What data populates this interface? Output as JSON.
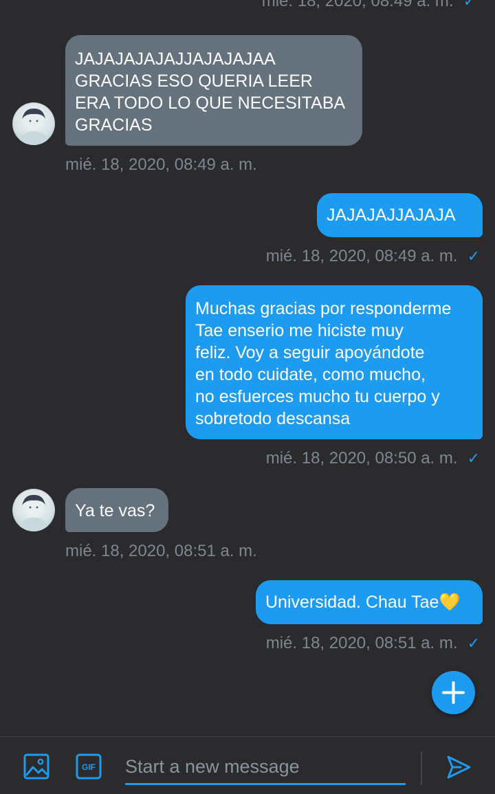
{
  "conversation": {
    "top_timestamp": "mié. 18, 2020, 08:49 a. m.",
    "messages": [
      {
        "direction": "incoming",
        "text": "JAJAJAJAJAJJAJAJAJAA\nGRACIAS ESO QUERIA LEER\nERA TODO LO QUE NECESITABA\nGRACIAS",
        "timestamp": "mié. 18, 2020, 08:49 a. m."
      },
      {
        "direction": "outgoing",
        "text": "JAJAJAJJAJAJA",
        "timestamp": "mié. 18, 2020, 08:49 a. m.",
        "read": true
      },
      {
        "direction": "outgoing",
        "text": "Muchas gracias por responderme\nTae enserio me hiciste muy\nfeliz. Voy a seguir apoyándote\nen todo cuidate, como mucho,\nno esfuerces mucho tu cuerpo y\nsobretodo descansa",
        "timestamp": "mié. 18, 2020, 08:50 a. m.",
        "read": true
      },
      {
        "direction": "incoming",
        "text": "Ya te vas?",
        "timestamp": "mié. 18, 2020, 08:51 a. m."
      },
      {
        "direction": "outgoing",
        "text": "Universidad. Chau Tae💛",
        "timestamp": "mié. 18, 2020, 08:51 a. m.",
        "read": true
      }
    ]
  },
  "icons": {
    "read_receipt": "checkmark-icon",
    "fab": "plus-icon",
    "media": "image-icon",
    "gif": "gif-icon",
    "send": "send-icon"
  },
  "composer": {
    "placeholder": "Start a new message",
    "value": "",
    "gif_label": "GIF"
  },
  "colors": {
    "background": "#2b2b2d",
    "incoming_bubble": "#65717c",
    "outgoing_bubble": "#1d9bf0",
    "accent": "#1d9bf0",
    "timestamp": "#7d8792"
  }
}
